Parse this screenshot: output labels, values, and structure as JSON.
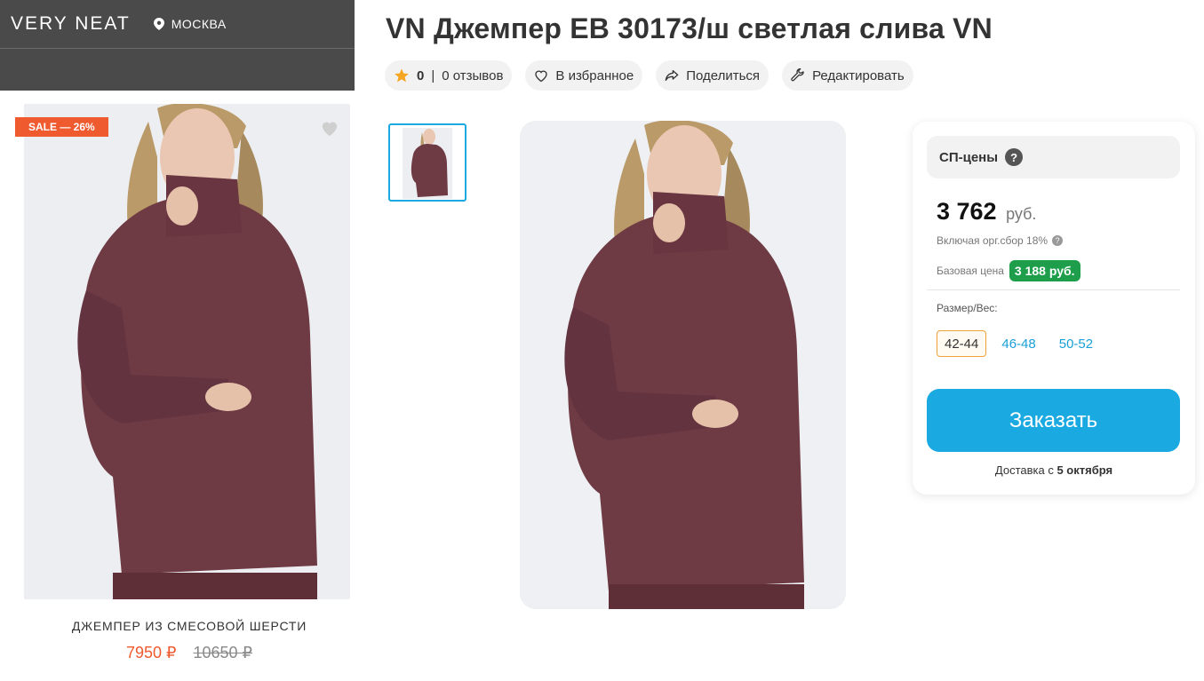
{
  "shop": {
    "brand": "VERY NEAT",
    "city": "МОСКВА"
  },
  "card": {
    "badge": "SALE — 26%",
    "title": "ДЖЕМПЕР ИЗ СМЕСОВОЙ ШЕРСТИ",
    "price_new": "7950 ₽",
    "price_old": "10650 ₽"
  },
  "product": {
    "title": "VN Джемпер ЕВ 30173/ш светлая слива VN",
    "rating": "0",
    "rating_sep": "|",
    "reviews": "0 отзывов",
    "favorite_label": "В избранное",
    "share_label": "Поделиться",
    "edit_label": "Редактировать"
  },
  "price_box": {
    "header": "СП-цены",
    "help": "?",
    "price": "3 762",
    "currency": "руб.",
    "included_fee": "Включая орг.сбор 18%",
    "base_label": "Базовая цена",
    "base_price": "3 188 руб.",
    "size_label": "Размер/Вес:",
    "sizes": [
      "42-44",
      "46-48",
      "50-52"
    ],
    "selected_size": "42-44",
    "order_label": "Заказать",
    "delivery_prefix": "Доставка с ",
    "delivery_date": "5 октября"
  },
  "colors": {
    "accent_blue": "#1aa9e1",
    "sale_orange": "#ef5a2f",
    "base_green": "#1e9e4b",
    "sweater_plum": "#6e3a44"
  }
}
